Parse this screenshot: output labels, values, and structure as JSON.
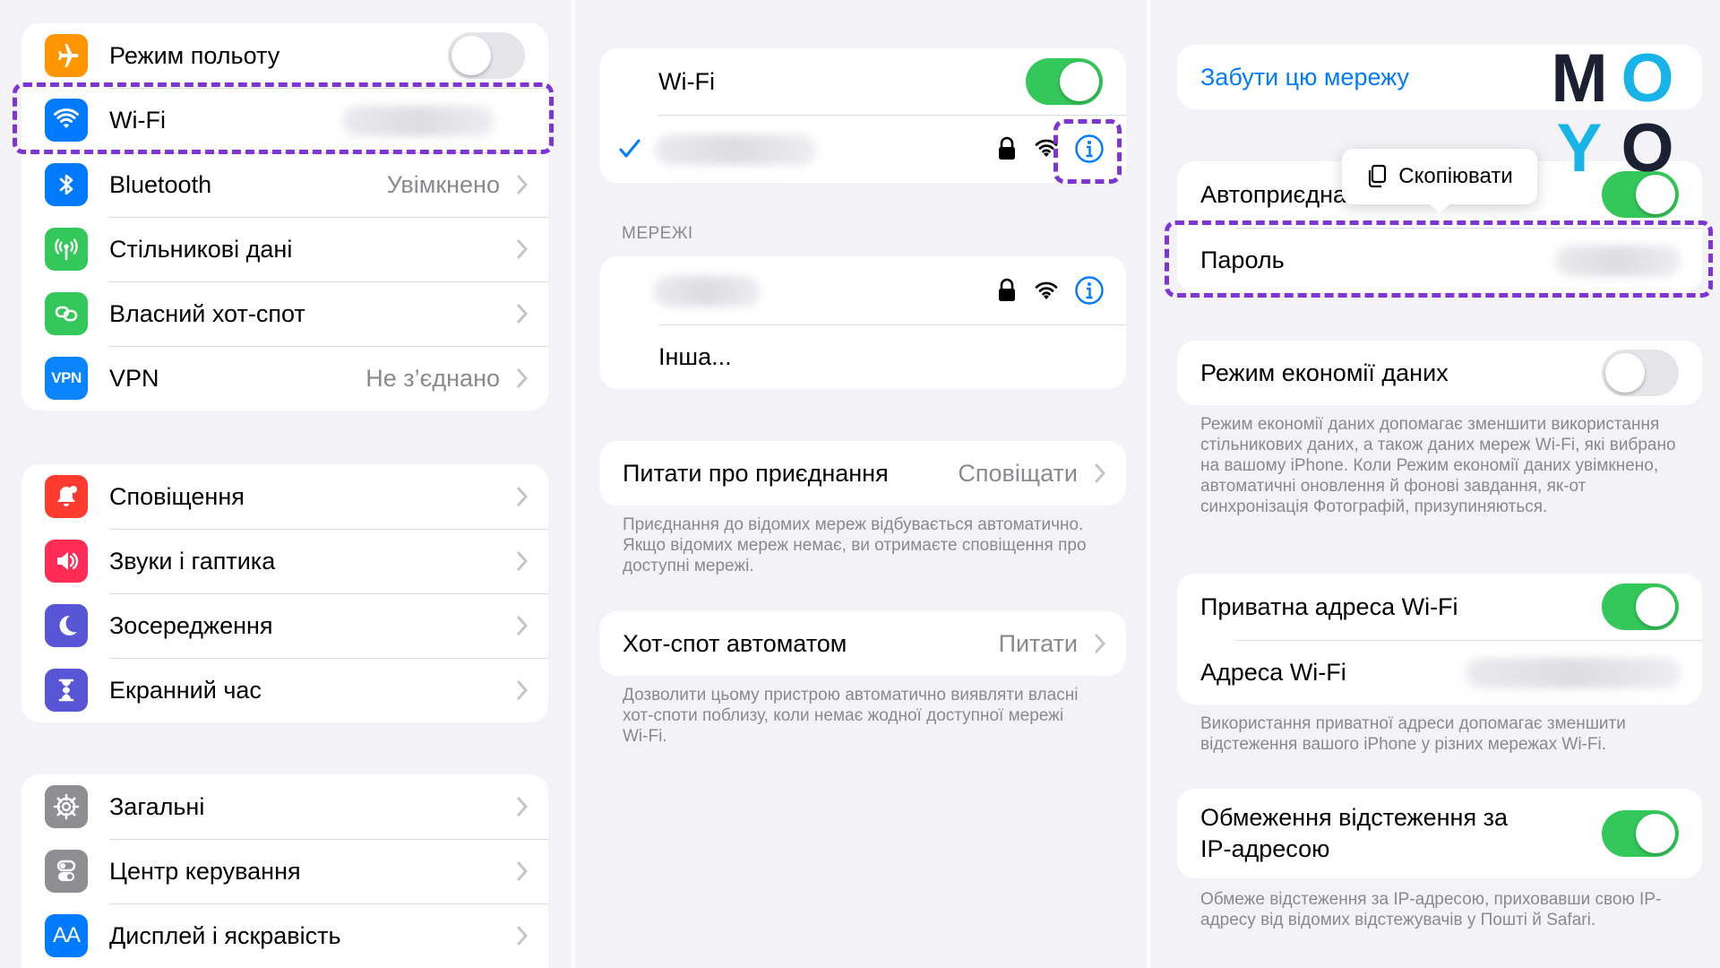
{
  "panel1": {
    "group1": [
      {
        "label": "Режим польоту",
        "icon": "airplane-icon",
        "color": "#ff9500",
        "toggle": "off"
      },
      {
        "label": "Wi-Fi",
        "icon": "wifi-icon",
        "color": "#007aff"
      },
      {
        "label": "Bluetooth",
        "value": "Увімкнено",
        "icon": "bluetooth-icon",
        "color": "#007aff"
      },
      {
        "label": "Стільникові дані",
        "icon": "antenna-icon",
        "color": "#34c759"
      },
      {
        "label": "Власний хот-спот",
        "icon": "hotspot-icon",
        "color": "#34c759"
      },
      {
        "label": "VPN",
        "value": "Не з’єднано",
        "icon": "vpn-icon",
        "color": "#0a84ff",
        "icon_text": "VPN"
      }
    ],
    "group2": [
      {
        "label": "Сповіщення",
        "icon": "bell-icon",
        "color": "#ff3b30"
      },
      {
        "label": "Звуки і гаптика",
        "icon": "speaker-icon",
        "color": "#ff2d55"
      },
      {
        "label": "Зосередження",
        "icon": "moon-icon",
        "color": "#5856d6"
      },
      {
        "label": "Екранний час",
        "icon": "hourglass-icon",
        "color": "#5856d6"
      }
    ],
    "group3": [
      {
        "label": "Загальні",
        "icon": "gear-icon",
        "color": "#8e8e93"
      },
      {
        "label": "Центр керування",
        "icon": "switches-icon",
        "color": "#8e8e93"
      },
      {
        "label": "Дисплей і яскравість",
        "icon": "text-size-icon",
        "color": "#007aff",
        "icon_text": "AA"
      }
    ]
  },
  "panel2": {
    "wifi_label": "Wi-Fi",
    "networks_header": "МЕРЕЖІ",
    "other_label": "Інша...",
    "ask_join_label": "Питати про приєднання",
    "ask_join_value": "Сповіщати",
    "ask_join_note": "Приєднання до відомих мереж відбувається автоматично. Якщо відомих мереж немає, ви отримаєте сповіщення про доступні мережі.",
    "hotspot_label": "Хот-спот автоматом",
    "hotspot_value": "Питати",
    "hotspot_note": "Дозволити цьому пристрою автоматично виявляти власні хот-споти поблизу, коли немає жодної доступної мережі Wi-Fi."
  },
  "panel3": {
    "forget_label": "Забути цю мережу",
    "autojoin_label": "Автоприєдна",
    "copy_label": "Скопіювати",
    "password_label": "Пароль",
    "low_data_label": "Режим економії даних",
    "low_data_note": "Режим економії даних допомагає зменшити використання стільникових даних, а також даних мереж Wi-Fi, які вибрано на вашому iPhone. Коли Режим економії даних увімкнено, автоматичні оновлення й фонові завдання, як-от синхронізація Фотографій, призупиняються.",
    "private_label": "Приватна адреса Wi-Fi",
    "address_label": "Адреса Wi-Fi",
    "private_note": "Використання приватної адреси допомагає зменшити відстеження вашого iPhone у різних мережах Wi-Fi.",
    "limit_line1": "Обмеження відстеження за",
    "limit_line2": "IP-адресою",
    "limit_note": "Обмеже відстеження за IP-адресою, приховавши свою IP-адресу від відомих відстежувачів у Пошті й Safari."
  },
  "logo": {
    "letters": [
      "M",
      "O",
      "Y",
      "O"
    ],
    "colors": [
      "#1c2033",
      "#18b4e8",
      "#18b4e8",
      "#1c2033"
    ]
  },
  "colors": {
    "accent": "#007aff",
    "toggle_on": "#34c759",
    "highlight": "#7e35d4"
  }
}
